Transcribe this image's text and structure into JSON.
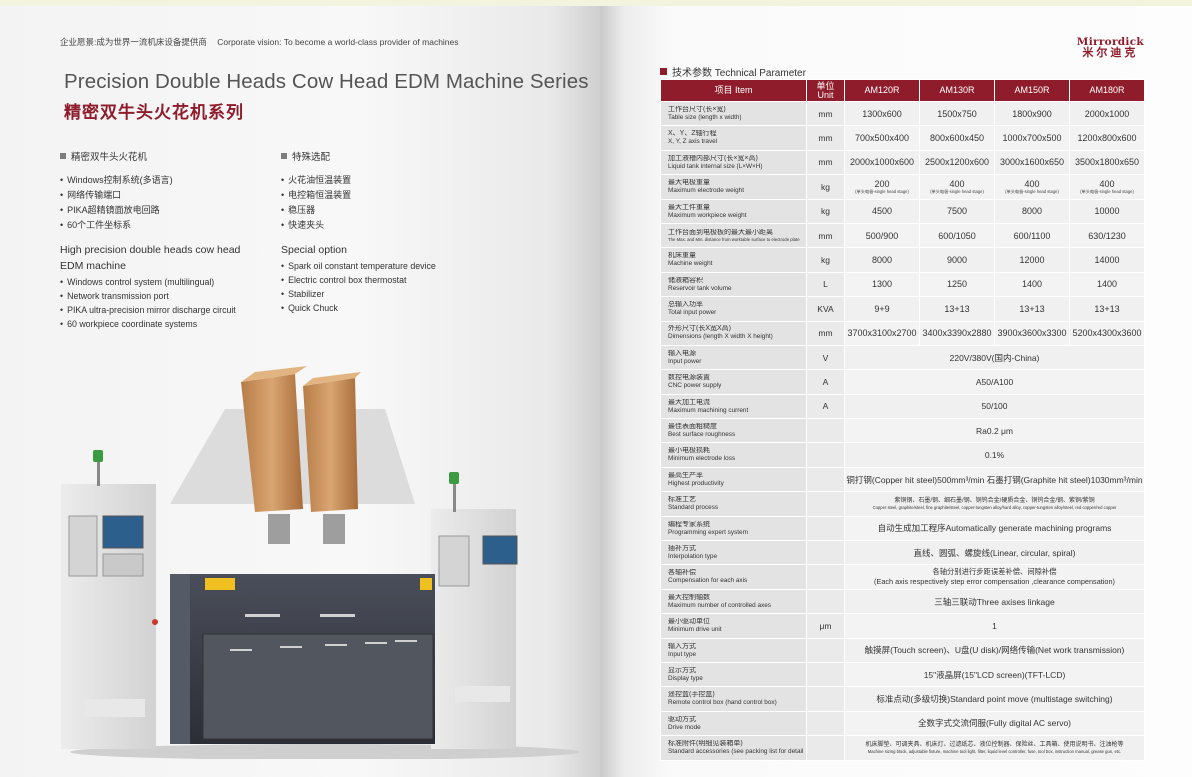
{
  "left": {
    "vision_cn": "企业愿景:成为世界一流机床设备提供商",
    "vision_en": "Corporate vision: To become a world-class provider of machines",
    "title_en": "Precision Double Heads Cow Head EDM Machine Series",
    "title_cn": "精密双牛头火花机系列",
    "features": {
      "heading_cn": "精密双牛头火花机",
      "items_cn": [
        "Windows控制系统(多语言)",
        "网络传输端口",
        "PIKA超精镜面放电回路",
        "60个工件坐标系"
      ],
      "heading_en_line1": "High precision double heads cow head",
      "heading_en_line2": "EDM machine",
      "items_en": [
        "Windows control system (multilingual)",
        "Network transmission port",
        "PIKA ultra-precision mirror discharge circuit",
        "60 workpiece coordinate systems"
      ]
    },
    "special": {
      "heading_cn": "特殊选配",
      "items_cn": [
        "火花油恒温装置",
        "电控箱恒温装置",
        "稳压器",
        "快速夹头"
      ],
      "heading_en": "Special option",
      "items_en": [
        "Spark oil constant temperature device",
        "Electric control box thermostat",
        "Stabilizer",
        "Quick Chuck"
      ]
    },
    "machine": {
      "brand_en": "Mirrordick",
      "brand_cn": "米尔迪克",
      "model_plate": "CNC-EDM AM120R"
    }
  },
  "right": {
    "brand_en": "Mirrordick",
    "brand_cn": "米尔迪克",
    "section_title": "技术参数 Technical Parameter",
    "table": {
      "header_item": "项目 Item",
      "header_unit_cn": "单位",
      "header_unit_en": "Unit",
      "models": [
        "AM120R",
        "AM130R",
        "AM150R",
        "AM180R"
      ],
      "rows": [
        {
          "cn": "工作台尺寸(长×宽)",
          "en": "Table size (length x width)",
          "unit": "mm",
          "values": [
            "1300x600",
            "1500x750",
            "1800x900",
            "2000x1000"
          ]
        },
        {
          "cn": "X、Y、Z轴行程",
          "en": "X, Y, Z axis travel",
          "unit": "mm",
          "values": [
            "700x500x400",
            "800x600x450",
            "1000x700x500",
            "1200x800x600"
          ]
        },
        {
          "cn": "加工液槽内部尺寸(长×宽×高)",
          "en": "Liquid tank internal size (L×W×H)",
          "unit": "mm",
          "values": [
            "2000x1000x600",
            "2500x1200x600",
            "3000x1600x650",
            "3500x1800x650"
          ]
        },
        {
          "cn": "最大电极重量",
          "en": "Maximum electrode weight",
          "unit": "kg",
          "values": [
            "200",
            "400",
            "400",
            "400"
          ],
          "subnote": "(单头电极-single head stage)"
        },
        {
          "cn": "最大工件重量",
          "en": "Maximum workpiece weight",
          "unit": "kg",
          "values": [
            "4500",
            "7500",
            "8000",
            "10000"
          ]
        },
        {
          "cn": "工作台面到电极板的最大最小距离",
          "en": "The Max. and Min. distance from worktable surface to electrode plate",
          "unit": "mm",
          "values": [
            "500/900",
            "600/1050",
            "600/1100",
            "630/1230"
          ],
          "small": true
        },
        {
          "cn": "机床重量",
          "en": "Machine weight",
          "unit": "kg",
          "values": [
            "8000",
            "9000",
            "12000",
            "14000"
          ]
        },
        {
          "cn": "储液箱容积",
          "en": "Reservoir tank volume",
          "unit": "L",
          "values": [
            "1300",
            "1250",
            "1400",
            "1400"
          ]
        },
        {
          "cn": "总输入功率",
          "en": "Total input power",
          "unit": "KVA",
          "values": [
            "9+9",
            "13+13",
            "13+13",
            "13+13"
          ]
        },
        {
          "cn": "外形尺寸(长X宽X高)",
          "en": "Dimensions (length X width X height)",
          "unit": "mm",
          "values": [
            "3700x3100x2700",
            "3400x3390x2880",
            "3900x3600x3300",
            "5200x4300x3600"
          ]
        },
        {
          "cn": "输入电源",
          "en": "Input power",
          "unit": "V",
          "span": "220V/380V(国内-China)"
        },
        {
          "cn": "数控电源装置",
          "en": "CNC power supply",
          "unit": "A",
          "span": "A50/A100"
        },
        {
          "cn": "最大加工电流",
          "en": "Maximum machining current",
          "unit": "A",
          "span": "50/100"
        },
        {
          "cn": "最佳表面粗糙度",
          "en": "Best surface roughness",
          "unit": "",
          "span": "Ra0.2 μm"
        },
        {
          "cn": "最小电极损耗",
          "en": "Minimum electrode loss",
          "unit": "",
          "span": "0.1%"
        },
        {
          "cn": "最高生产率",
          "en": "Highest productivity",
          "unit": "",
          "span": "铜打钢(Copper hit steel)500mm³/min 石墨打钢(Graphite hit steel)1030mm³/min"
        },
        {
          "cn": "标准工艺",
          "en": "Standard process",
          "unit": "",
          "span_cn": "紫铜钢、石墨/钢、细石墨/钢、铜钨合金/硬质合金、铜钨合金/钢、紫铜/紫铜",
          "span_en": "Copper steel, graphite/steel, fine graphite/steel, copper-tungsten alloy/hard alloy, copper-tungsten alloy/steel, red copper/red copper"
        },
        {
          "cn": "编程专家系统",
          "en": "Programming expert system",
          "unit": "",
          "span": "自动生成加工程序Automatically generate machining programs"
        },
        {
          "cn": "插补方式",
          "en": "Interpolation type",
          "unit": "",
          "span": "直线、圆弧、螺旋线(Linear, circular, spiral)"
        },
        {
          "cn": "各轴补偿",
          "en": "Compensation for each axis",
          "unit": "",
          "span_cn": "各轴分别进行步距误差补偿、间隙补偿",
          "span_en": "(Each axis respectively step error compensation ,clearance compensation)",
          "mid": true
        },
        {
          "cn": "最大控制轴数",
          "en": "Maximum number of controlled axes",
          "unit": "",
          "span": "三轴三联动Three axises linkage"
        },
        {
          "cn": "最小驱动单位",
          "en": "Minimum drive unit",
          "unit": "μm",
          "span": "1"
        },
        {
          "cn": "输入方式",
          "en": "Input type",
          "unit": "",
          "span": "触摸屏(Touch screen)、U盘(U disk)/网络传输(Net work transmission)"
        },
        {
          "cn": "显示方式",
          "en": "Display type",
          "unit": "",
          "span": "15\"液晶屏(15\"LCD screen)(TFT-LCD)"
        },
        {
          "cn": "遥控盒(手控盒)",
          "en": "Remote control box (hand control box)",
          "unit": "",
          "span": "标准点动(多级切换)Standard point move (multistage switching)"
        },
        {
          "cn": "驱动方式",
          "en": "Drive mode",
          "unit": "",
          "span": "全数字式交流伺服(Fully digital AC servo)"
        },
        {
          "cn": "标准附件(明细见装箱单)",
          "en": "Standard accessories (see packing list for details)",
          "unit": "",
          "span_cn": "机床脚垫、可调夹具、机床灯、过滤纸芯、液位控制器、保险丝、工具箱、使用说明书、注油枪等",
          "span_en": "Machine sizing block, adjustable fixture, machine tool light, filter, liquid level controller, fuse, tool box, instruction manual, grease gun, etc."
        }
      ]
    }
  },
  "colors": {
    "brand_red": "#8e1c2b",
    "header_bg": "#8e1c2b",
    "cell_gray": "#e3e3e3"
  }
}
